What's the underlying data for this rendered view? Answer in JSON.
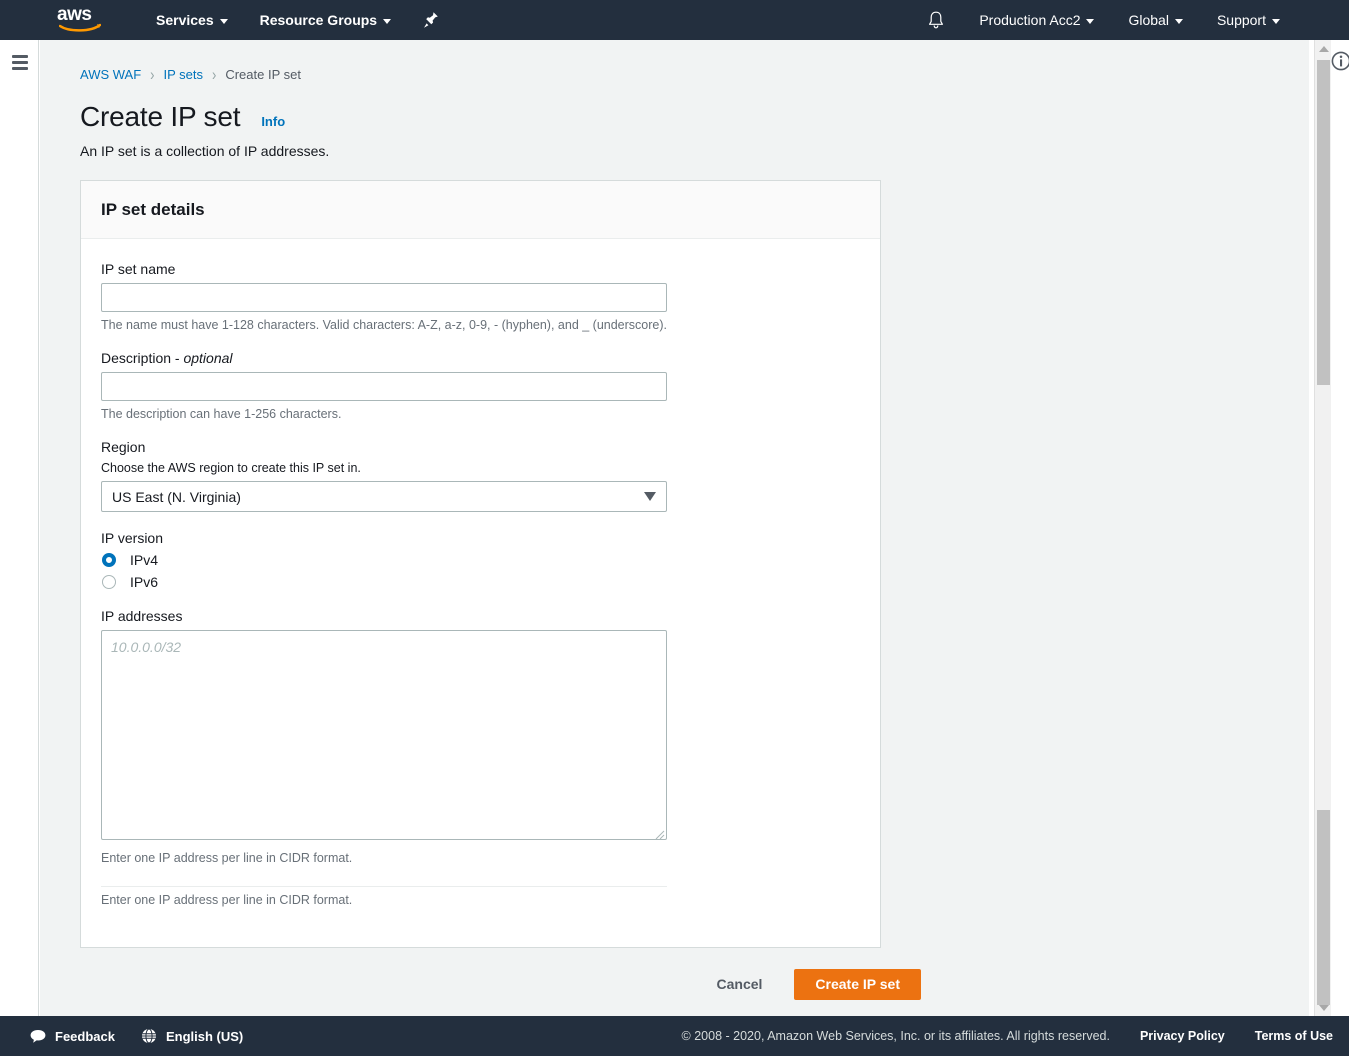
{
  "topnav": {
    "logo_text": "aws",
    "logo_name": "aws-logo",
    "services_label": "Services",
    "resource_groups_label": "Resource Groups",
    "pin_icon": "pin-icon",
    "bell_icon": "bell-icon",
    "account_label": "Production Acc2",
    "region_label": "Global",
    "support_label": "Support"
  },
  "sidebar": {
    "menu_icon": "hamburger-menu-icon"
  },
  "breadcrumb": {
    "items": [
      {
        "label": "AWS WAF",
        "link": true
      },
      {
        "label": "IP sets",
        "link": true
      },
      {
        "label": "Create IP set",
        "link": false
      }
    ],
    "separator": "›"
  },
  "page": {
    "title": "Create IP set",
    "info_label": "Info",
    "description": "An IP set is a collection of IP addresses."
  },
  "card": {
    "header": "IP set details",
    "name_field": {
      "label": "IP set name",
      "value": "",
      "placeholder": "",
      "hint": "The name must have 1-128 characters. Valid characters: A-Z, a-z, 0-9, - (hyphen), and _ (underscore)."
    },
    "description_field": {
      "label": "Description - ",
      "label_optional": "optional",
      "value": "",
      "placeholder": "",
      "hint": "The description can have 1-256 characters."
    },
    "region_field": {
      "label": "Region",
      "sublabel": "Choose the AWS region to create this IP set in.",
      "selected": "US East (N. Virginia)"
    },
    "ip_version_field": {
      "label": "IP version",
      "options": [
        {
          "label": "IPv4",
          "selected": true
        },
        {
          "label": "IPv6",
          "selected": false
        }
      ]
    },
    "ip_addresses_field": {
      "label": "IP addresses",
      "value": "",
      "placeholder": "10.0.0.0/32",
      "hint": "Enter one IP address per line in CIDR format.",
      "hint_secondary": "Enter one IP address per line in CIDR format."
    }
  },
  "actions": {
    "cancel_label": "Cancel",
    "submit_label": "Create IP set",
    "accent_color": "#ec7211"
  },
  "scroll": {
    "up_arrow": "scroll-up-arrow",
    "down_arrow": "scroll-down-arrow"
  },
  "info_tab": {
    "icon": "info-circle-icon"
  },
  "footer": {
    "feedback_label": "Feedback",
    "language_label": "English (US)",
    "copyright": "© 2008 - 2020, Amazon Web Services, Inc. or its affiliates. All rights reserved.",
    "privacy_label": "Privacy Policy",
    "terms_label": "Terms of Use"
  }
}
